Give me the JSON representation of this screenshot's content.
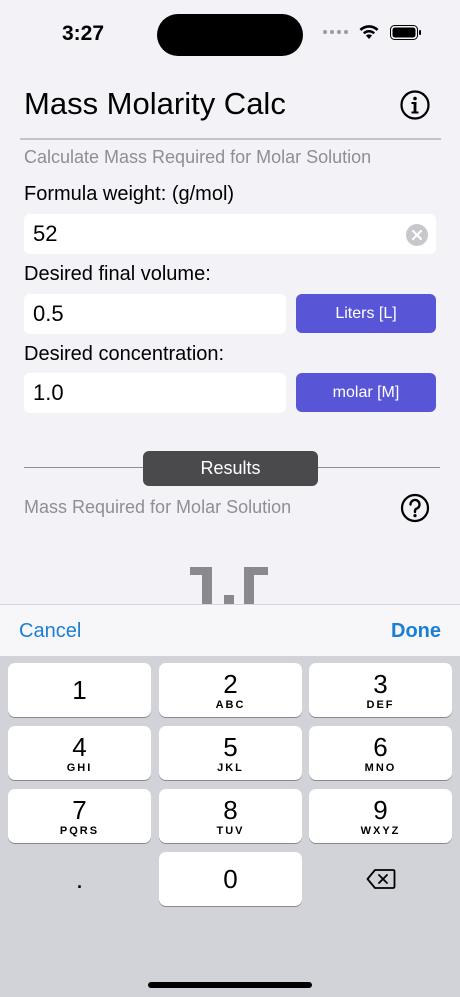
{
  "status_bar": {
    "time": "3:27"
  },
  "header": {
    "title": "Mass Molarity Calc"
  },
  "subtitle": "Calculate Mass Required for Molar Solution",
  "formula_weight": {
    "label": "Formula weight:  (g/mol)",
    "value": "52"
  },
  "volume": {
    "label": "Desired final volume:",
    "value": "0.5",
    "unit": "Liters [L]"
  },
  "concentration": {
    "label": "Desired concentration:",
    "value": "1.0",
    "unit": "molar [M]"
  },
  "results": {
    "heading": "Results",
    "label": "Mass Required for Molar Solution"
  },
  "toolbar": {
    "cancel": "Cancel",
    "done": "Done"
  },
  "keypad": {
    "keys": [
      {
        "digit": "1",
        "letters": ""
      },
      {
        "digit": "2",
        "letters": "ABC"
      },
      {
        "digit": "3",
        "letters": "DEF"
      },
      {
        "digit": "4",
        "letters": "GHI"
      },
      {
        "digit": "5",
        "letters": "JKL"
      },
      {
        "digit": "6",
        "letters": "MNO"
      },
      {
        "digit": "7",
        "letters": "PQRS"
      },
      {
        "digit": "8",
        "letters": "TUV"
      },
      {
        "digit": "9",
        "letters": "WXYZ"
      },
      {
        "digit": "0",
        "letters": ""
      }
    ],
    "decimal": "."
  },
  "colors": {
    "accent": "#5856d6",
    "link": "#1a7fd4",
    "results_pill": "#4a4a4c"
  },
  "icons": [
    "wifi-icon",
    "battery-icon",
    "info-icon",
    "clear-icon",
    "help-icon",
    "backspace-icon"
  ]
}
